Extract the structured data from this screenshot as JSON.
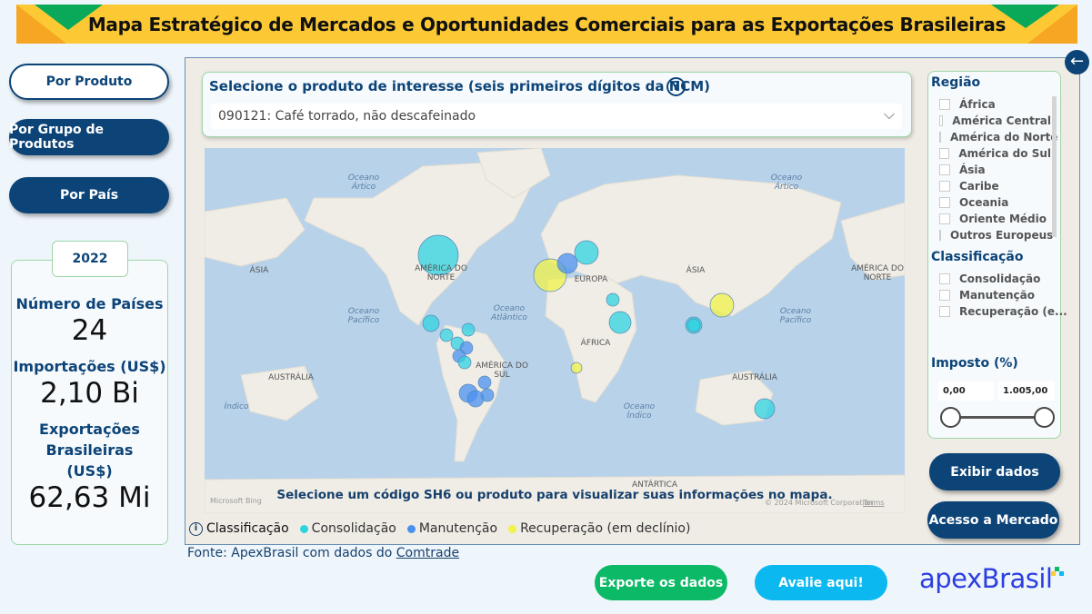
{
  "header": {
    "title": "Mapa Estratégico de Mercados e Oportunidades Comerciais para as Exportações Brasileiras"
  },
  "nav": {
    "by_product": "Por Produto",
    "by_group": "Por Grupo de Produtos",
    "by_country": "Por País"
  },
  "stats": {
    "year": "2022",
    "countries_label": "Número de Países",
    "countries_value": "24",
    "imports_label": "Importações (US$)",
    "imports_value": "2,10 Bi",
    "exports_label": "Exportações Brasileiras (US$)",
    "exports_value": "62,63 Mi"
  },
  "selector": {
    "title": "Selecione o produto de interesse (seis primeiros dígitos da NCM)",
    "help": "?",
    "selected": "090121: Café torrado, não descafeinado"
  },
  "map": {
    "labels": {
      "oceano_artico_1": "Oceano Ártico",
      "oceano_artico_2": "Oceano Ártico",
      "asia_w": "ÁSIA",
      "america_norte": "AMÉRICA DO NORTE",
      "europa": "EUROPA",
      "asia": "ÁSIA",
      "america_norte_e": "AMÉRICA DO NORTE",
      "oceano_pacifico_1": "Oceano Pacífico",
      "oceano_atlantico": "Oceano Atlântico",
      "oceano_pacifico_2": "Oceano Pacífico",
      "africa": "ÁFRICA",
      "australia_w": "AUSTRÁLIA",
      "america_sul": "AMÉRICA DO SUL",
      "australia": "AUSTRÁLIA",
      "oceano_indico_w": "Índico",
      "oceano_indico": "Oceano Índico",
      "antartica": "ANTÁRTICA"
    },
    "message": "Selecione um código SH6 ou produto para visualizar suas informações no mapa.",
    "bing": "Microsoft Bing",
    "copyright": "© 2024 Microsoft Corporation",
    "terms": "Terms"
  },
  "legend": {
    "title": "Classificação",
    "items": [
      {
        "label": "Consolidação",
        "color": "#2fd3e0"
      },
      {
        "label": "Manutenção",
        "color": "#4a90f0"
      },
      {
        "label": "Recuperação (em declínio)",
        "color": "#f2f24a"
      }
    ]
  },
  "source": {
    "prefix": "Fonte: ApexBrasil com dados do ",
    "link": "Comtrade"
  },
  "filters": {
    "region_title": "Região",
    "regions": [
      "África",
      "América Central",
      "América do Norte",
      "América do Sul",
      "Ásia",
      "Caribe",
      "Oceania",
      "Oriente Médio",
      "Outros Europeus"
    ],
    "class_title": "Classificação",
    "classes": [
      "Consolidação",
      "Manutenção",
      "Recuperação (e..."
    ],
    "tax_title": "Imposto (%)",
    "tax_min": "0,00",
    "tax_max": "1.005,00"
  },
  "actions": {
    "show_data": "Exibir dados",
    "market_access": "Acesso a Mercado",
    "export": "Exporte os dados",
    "rate": "Avalie aqui!"
  },
  "logo": "apexBrasil",
  "colors": {
    "brand": "#0d4478",
    "banner": "#fcc934",
    "export_btn": "#0cb966",
    "rate_btn": "#0bb8f0"
  }
}
